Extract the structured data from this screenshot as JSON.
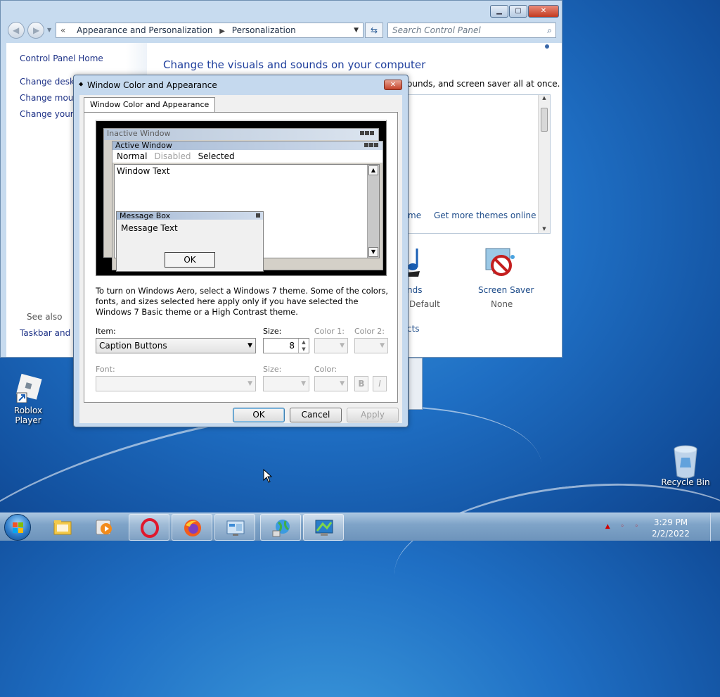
{
  "control_panel": {
    "breadcrumb": [
      "Appearance and Personalization",
      "Personalization"
    ],
    "search_placeholder": "Search Control Panel",
    "left_nav": {
      "home": "Control Panel Home",
      "links": [
        "Change deskto",
        "Change mouse",
        "Change your a"
      ],
      "see_also": "See also",
      "see_also_links": [
        "Taskbar and St"
      ]
    },
    "main": {
      "title": "Change the visuals and sounds on your computer",
      "subtitle_tail": "ounds, and screen saver all at once.",
      "theme_link_partial": "me",
      "get_more_themes": "Get more themes online",
      "sounds_label_partial": "nds",
      "sounds_value_partial": "Default",
      "screen_saver_label": "Screen Saver",
      "screen_saver_value": "None",
      "link_partial": "cts"
    }
  },
  "dialog": {
    "title": "Window Color and Appearance",
    "tab": "Window Color and Appearance",
    "preview": {
      "inactive_window": "Inactive Window",
      "active_window": "Active Window",
      "menu_normal": "Normal",
      "menu_disabled": "Disabled",
      "menu_selected": "Selected",
      "window_text": "Window Text",
      "message_box": "Message Box",
      "message_text": "Message Text",
      "ok": "OK"
    },
    "info_text": "To turn on Windows Aero, select a Windows 7 theme.  Some of the colors, fonts, and sizes selected here apply only if you have selected the Windows 7 Basic theme or a High Contrast theme.",
    "item_label": "Item:",
    "item_value": "Caption Buttons",
    "size_label": "Size:",
    "size_value": "8",
    "color1_label": "Color 1:",
    "color2_label": "Color 2:",
    "font_label": "Font:",
    "font_size_label": "Size:",
    "font_color_label": "Color:",
    "bold_label": "B",
    "italic_label": "I",
    "ok_button": "OK",
    "cancel_button": "Cancel",
    "apply_button": "Apply"
  },
  "desktop": {
    "icons": [
      {
        "label": "Roblox Player",
        "icon": "roblox-icon"
      },
      {
        "label": "Recycle Bin",
        "icon": "recycle-bin-icon"
      }
    ]
  },
  "taskbar": {
    "time": "3:29 PM",
    "date": "2/2/2022",
    "pinned": [
      "explorer-icon",
      "media-player-icon",
      "opera-icon",
      "firefox-icon",
      "control-panel-icon",
      "network-globe-icon",
      "display-settings-icon"
    ]
  },
  "colors": {
    "link_blue": "#1e3287",
    "title_blue": "#1e3e9c",
    "desktop_blue": "#1f6fc4"
  }
}
